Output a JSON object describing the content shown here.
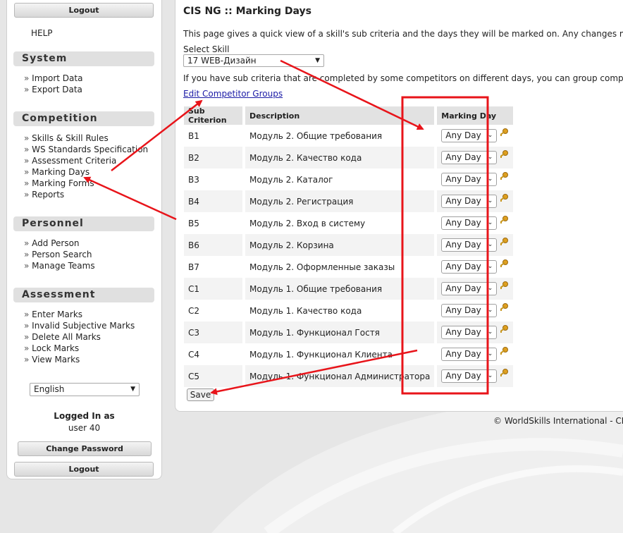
{
  "sidebar": {
    "logout_top": "Logout",
    "help": "HELP",
    "sections": [
      {
        "title": "System",
        "items": [
          "Import Data",
          "Export Data"
        ]
      },
      {
        "title": "Competition",
        "items": [
          "Skills & Skill Rules",
          "WS Standards Specification",
          "Assessment Criteria",
          "Marking Days",
          "Marking Forms",
          "Reports"
        ]
      },
      {
        "title": "Personnel",
        "items": [
          "Add Person",
          "Person Search",
          "Manage Teams"
        ]
      },
      {
        "title": "Assessment",
        "items": [
          "Enter Marks",
          "Invalid Subjective Marks",
          "Delete All Marks",
          "Lock Marks",
          "View Marks"
        ]
      }
    ],
    "language": "English",
    "logged_in_label": "Logged In as",
    "user": "user 40",
    "change_password": "Change Password",
    "logout_bottom": "Logout"
  },
  "main": {
    "title": "CIS NG :: Marking Days",
    "intro": "This page gives a quick view of a skill's sub criteria and the days they will be marked on. Any changes made",
    "skill_label": "Select Skill",
    "skill_value": "17 WEB-Дизайн",
    "group_text": "If you have sub criteria that are completed by some competitors on different days, you can group competitor",
    "edit_groups_link": "Edit Competitor Groups",
    "table": {
      "headers": [
        "Sub Criterion",
        "Description",
        "Marking Day"
      ],
      "rows": [
        {
          "code": "B1",
          "description": "Модуль 2. Общие требования",
          "day": "Any Day"
        },
        {
          "code": "B2",
          "description": "Модуль 2. Качество кода",
          "day": "Any Day"
        },
        {
          "code": "B3",
          "description": "Модуль 2. Каталог",
          "day": "Any Day"
        },
        {
          "code": "B4",
          "description": "Модуль 2. Регистрация",
          "day": "Any Day"
        },
        {
          "code": "B5",
          "description": "Модуль 2. Вход в систему",
          "day": "Any Day"
        },
        {
          "code": "B6",
          "description": "Модуль 2. Корзина",
          "day": "Any Day"
        },
        {
          "code": "B7",
          "description": "Модуль 2. Оформленные заказы",
          "day": "Any Day"
        },
        {
          "code": "C1",
          "description": "Модуль 1. Общие требования",
          "day": "Any Day"
        },
        {
          "code": "C2",
          "description": "Модуль 1. Качество кода",
          "day": "Any Day"
        },
        {
          "code": "C3",
          "description": "Модуль 1. Функционал Гостя",
          "day": "Any Day"
        },
        {
          "code": "C4",
          "description": "Модуль 1. Функционал Клиента",
          "day": "Any Day"
        },
        {
          "code": "C5",
          "description": "Модуль 1. Функционал Администратора",
          "day": "Any Day"
        }
      ]
    },
    "save_label": "Save"
  },
  "footer": "© WorldSkills International - CIS",
  "colors": {
    "annotation": "#e8141a",
    "link": "#1a1aa6",
    "header_bg": "#e2e2e2"
  },
  "icons": {
    "row_action": "key-icon",
    "dropdown": "chevron-down-icon"
  }
}
